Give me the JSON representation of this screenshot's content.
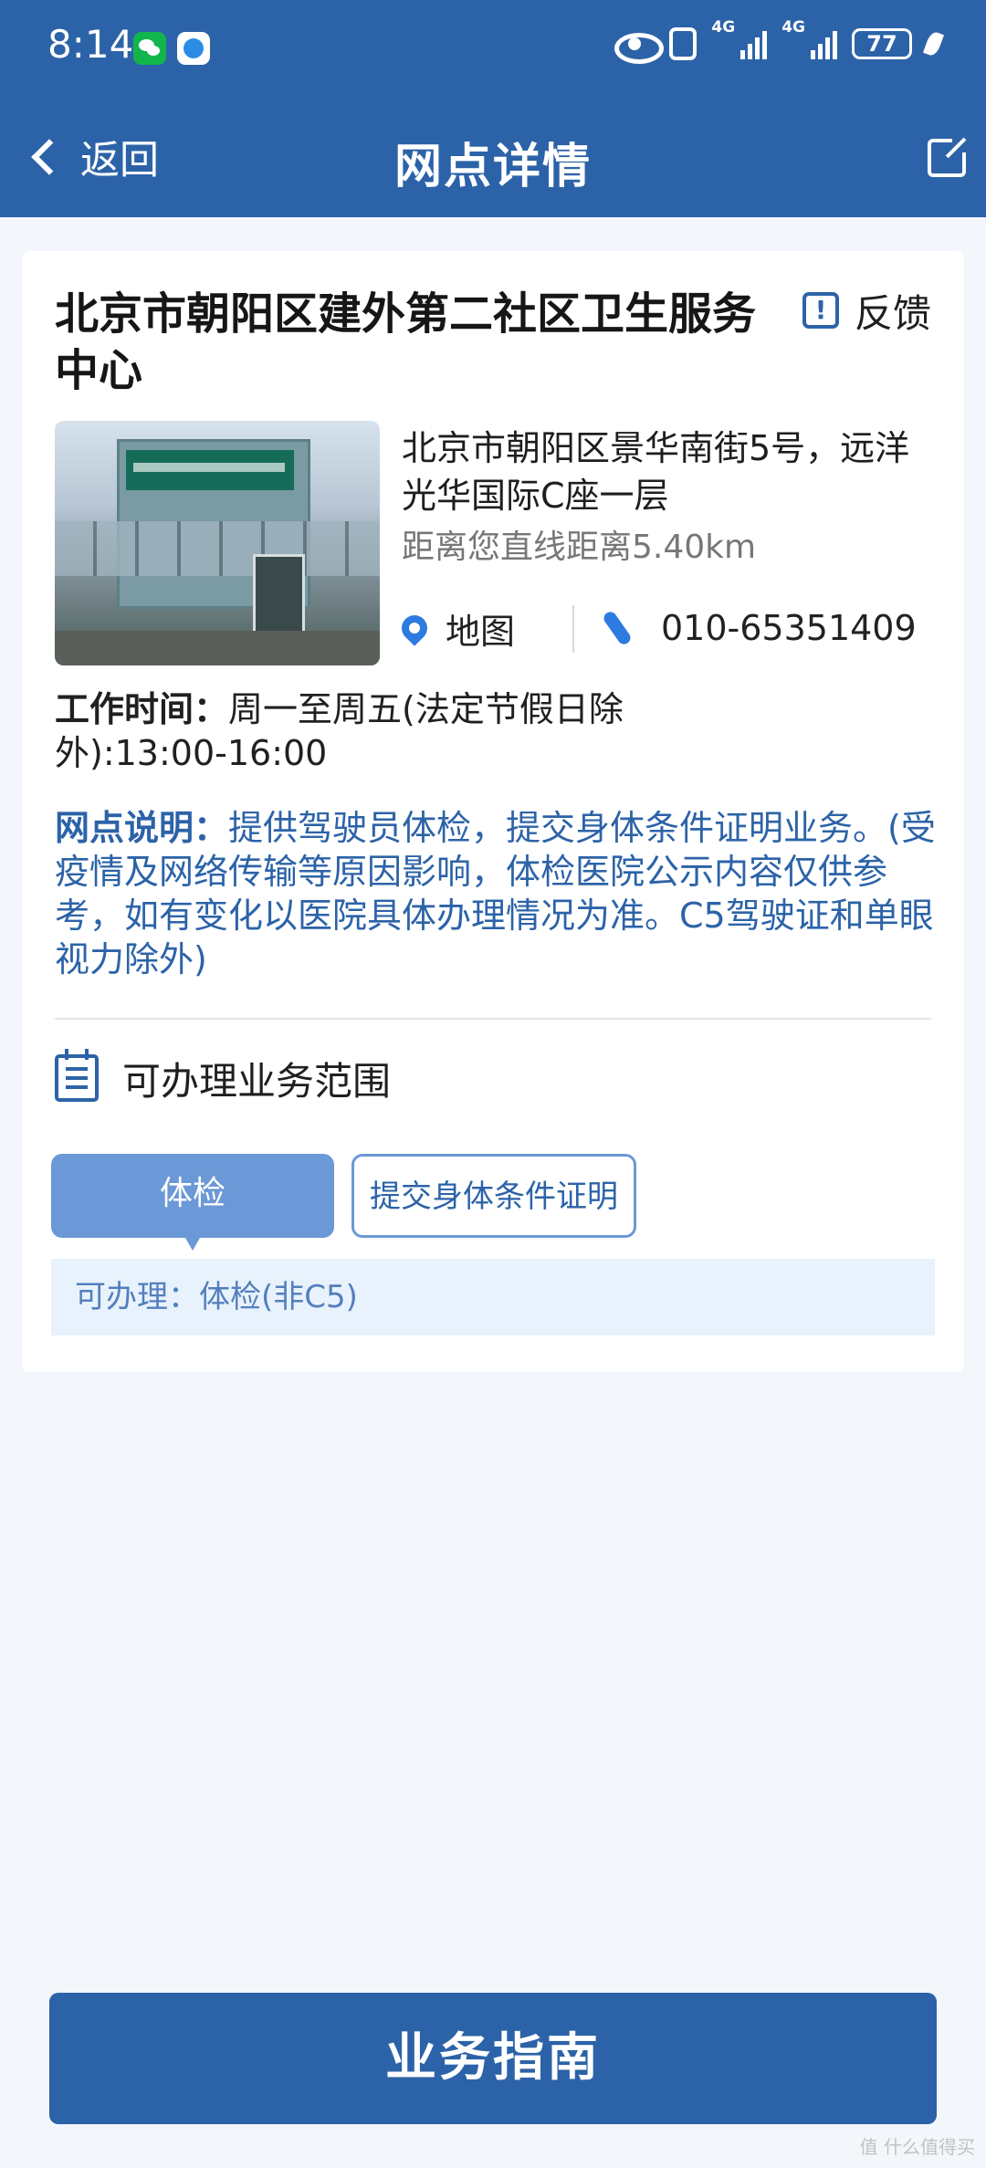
{
  "status": {
    "time": "8:14",
    "network_1": "4G",
    "network_2": "4G",
    "battery": "77"
  },
  "header": {
    "back_label": "返回",
    "title": "网点详情"
  },
  "site": {
    "name": "北京市朝阳区建外第二社区卫生服务中心",
    "feedback_label": "反馈",
    "address": "北京市朝阳区景华南街5号，远洋光华国际C座一层",
    "distance": "距离您直线距离5.40km",
    "map_label": "地图",
    "phone": "010-65351409",
    "hours_label": "工作时间：",
    "hours": "周一至周五(法定节假日除外):13:00-16:00",
    "description_label": "网点说明：",
    "description": "提供驾驶员体检，提交身体条件证明业务。(受疫情及网络传输等原因影响，体检医院公示内容仅供参考，如有变化以医院具体办理情况为准。C5驾驶证和单眼视力除外)"
  },
  "services": {
    "section_title": "可办理业务范围",
    "tabs": [
      {
        "label": "体检",
        "active": true
      },
      {
        "label": "提交身体条件证明",
        "active": false
      }
    ],
    "available": "可办理：体检(非C5)"
  },
  "bottom_button_label": "业务指南",
  "watermark": "值 什么值得买",
  "colors": {
    "primary": "#2c63a8",
    "accent": "#6b98d6",
    "link_blue": "#2d7be0",
    "background": "#f3f6fa"
  },
  "icons": [
    "wechat-icon",
    "app-icon",
    "eye-icon",
    "nfc-icon",
    "signal-icon",
    "battery-icon",
    "leaf-icon",
    "chevron-left-icon",
    "share-icon",
    "feedback-icon",
    "map-pin-icon",
    "phone-icon",
    "calendar-icon"
  ]
}
